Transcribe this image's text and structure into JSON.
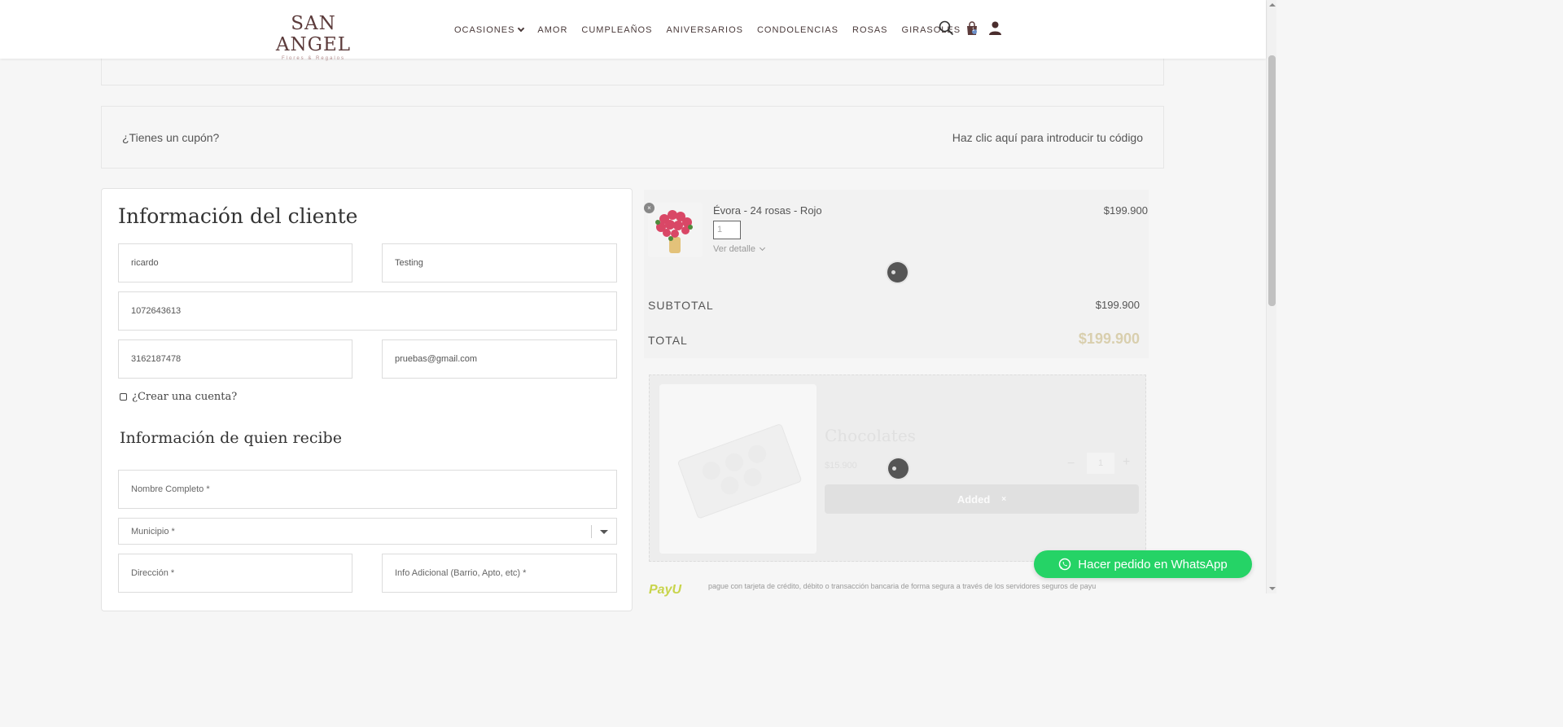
{
  "header": {
    "logo_main": "SAN ANGEL",
    "logo_sub": "Flores & Regalos",
    "nav": [
      "OCASIONES",
      "AMOR",
      "CUMPLEAÑOS",
      "ANIVERSARIOS",
      "CONDOLENCIAS",
      "ROSAS",
      "GIRASOLES"
    ],
    "cart_count": "1",
    "icons": [
      "search-icon",
      "cart-icon",
      "user-icon"
    ]
  },
  "coupon": {
    "question": "¿Tienes un cupón?",
    "link": "Haz clic aquí para introducir tu código"
  },
  "customer": {
    "title": "Información del cliente",
    "first_name": "ricardo",
    "last_name": "Testing",
    "document": "1072643613",
    "phone": "3162187478",
    "email": "pruebas@gmail.com",
    "create_account": "¿Crear una cuenta?"
  },
  "recipient": {
    "title": "Información de quien recibe",
    "name_placeholder": "Nombre Completo *",
    "municipio_placeholder": "Municipio *",
    "address_placeholder": "Dirección *",
    "extra_placeholder": "Info Adicional (Barrio, Apto, etc) *"
  },
  "order": {
    "product_name": "Évora - 24 rosas - Rojo",
    "product_price": "$199.900",
    "quantity": "1",
    "details_label": "Ver detalle",
    "subtotal_label": "SUBTOTAL",
    "subtotal_value": "$199.900",
    "total_label": "TOTAL",
    "total_value": "$199.900"
  },
  "upsell": {
    "title": "Chocolates",
    "price": "$15.900",
    "quantity": "1",
    "added_label": "Added",
    "added_close": "×"
  },
  "payment": {
    "logo": "PayU",
    "text": "pague con tarjeta de crédito, débito o transacción bancaria de forma segura a través de los servidores seguros de payu"
  },
  "whatsapp": {
    "label": "Hacer pedido en WhatsApp"
  },
  "colors": {
    "brand": "#5c3b3b",
    "whatsapp": "#25d366",
    "total_accent": "#d9cfae"
  }
}
